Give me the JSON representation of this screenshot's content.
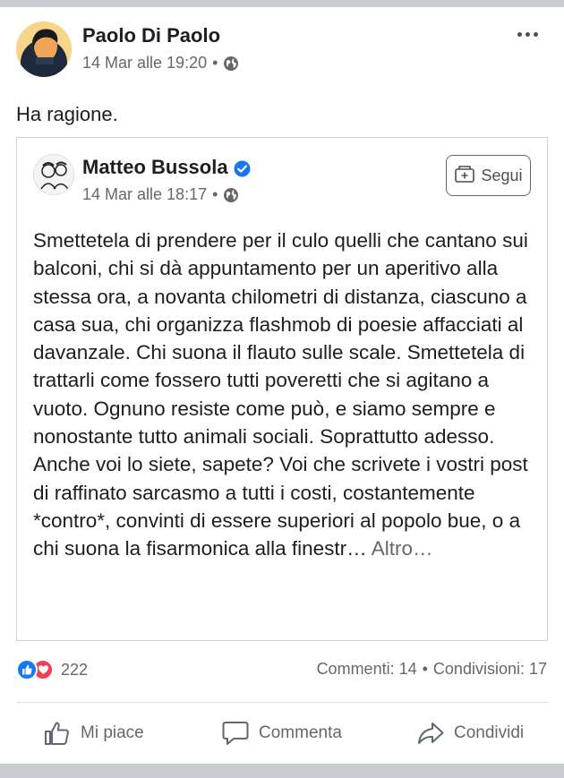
{
  "post": {
    "author": "Paolo Di Paolo",
    "timestamp": "14 Mar alle 19:20",
    "separator": "•",
    "privacy_icon": "globe-icon",
    "text": "Ha ragione."
  },
  "shared": {
    "author": "Matteo Bussola",
    "verified_icon": "verified-badge-icon",
    "timestamp": "14 Mar alle 18:17",
    "separator": "•",
    "follow_label": "Segui",
    "body": "Smettetela di prendere per il culo quelli che cantano sui balconi, chi si dà appuntamento per un aperitivo alla stessa ora, a novanta chilometri di distanza, ciascuno a casa sua, chi organizza flashmob di poesie affacciati al davanzale. Chi suona il flauto sulle scale. Smettetela di trattarli come fossero tutti poveretti che si agitano a vuoto. Ognuno resiste come può, e siamo sempre e nonostante tutto animali sociali. Soprattutto adesso. Anche voi lo siete, sapete? Voi che scrivete i vostri post di raffinato sarcasmo a tutti i costi, costantemente *contro*, convinti di essere superiori al popolo bue, o a chi suona la fisarmonica alla finestr…",
    "more_label": "Altro…"
  },
  "engagement": {
    "reactions_count": "222",
    "comments": "Commenti: 14",
    "dot": "•",
    "shares": "Condivisioni: 17"
  },
  "actions": {
    "like": "Mi piace",
    "comment": "Commenta",
    "share": "Condividi"
  },
  "colors": {
    "like_blue": "#1877f2",
    "love_red": "#f33e58",
    "verified_blue": "#1877f2",
    "secondary_text": "#65676b"
  }
}
